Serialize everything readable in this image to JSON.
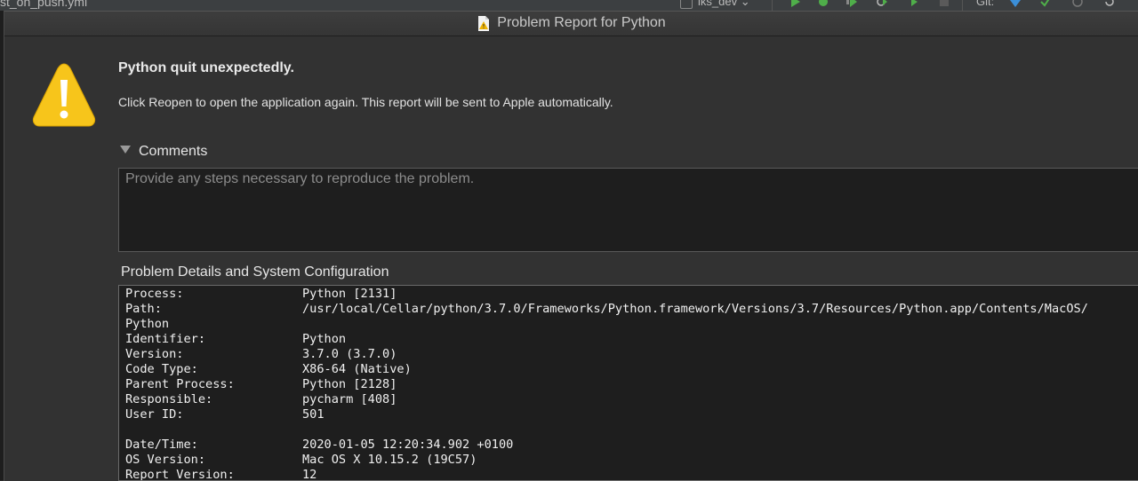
{
  "background_ide": {
    "file_tab": "st_on_push.yml",
    "branch": "iks_dev",
    "git_label": "Git:"
  },
  "window": {
    "title": "Problem Report for Python",
    "title_icon": "problem-report-document-icon"
  },
  "message": {
    "icon": "warning-triangle-icon",
    "headline": "Python quit unexpectedly.",
    "subtext": "Click Reopen to open the application again. This report will be sent to Apple automatically."
  },
  "comments": {
    "label": "Comments",
    "expanded": true,
    "value": "",
    "placeholder": "Provide any steps necessary to reproduce the problem."
  },
  "details": {
    "label": "Problem Details and System Configuration",
    "lines": [
      {
        "key": "Process:",
        "value": "Python [2131]"
      },
      {
        "key": "Path:",
        "value": "/usr/local/Cellar/python/3.7.0/Frameworks/Python.framework/Versions/3.7/Resources/Python.app/Contents/MacOS/"
      },
      {
        "key": "Python",
        "value": ""
      },
      {
        "key": "Identifier:",
        "value": "Python"
      },
      {
        "key": "Version:",
        "value": "3.7.0 (3.7.0)"
      },
      {
        "key": "Code Type:",
        "value": "X86-64 (Native)"
      },
      {
        "key": "Parent Process:",
        "value": "Python [2128]"
      },
      {
        "key": "Responsible:",
        "value": "pycharm [408]"
      },
      {
        "key": "User ID:",
        "value": "501"
      },
      {
        "key": "",
        "value": ""
      },
      {
        "key": "Date/Time:",
        "value": "2020-01-05 12:20:34.902 +0100"
      },
      {
        "key": "OS Version:",
        "value": "Mac OS X 10.15.2 (19C57)"
      },
      {
        "key": "Report Version:",
        "value": "12"
      }
    ]
  },
  "colors": {
    "window_bg": "#323232",
    "text_box_bg": "#1e1e1e",
    "warning_yellow": "#f7c51b"
  }
}
